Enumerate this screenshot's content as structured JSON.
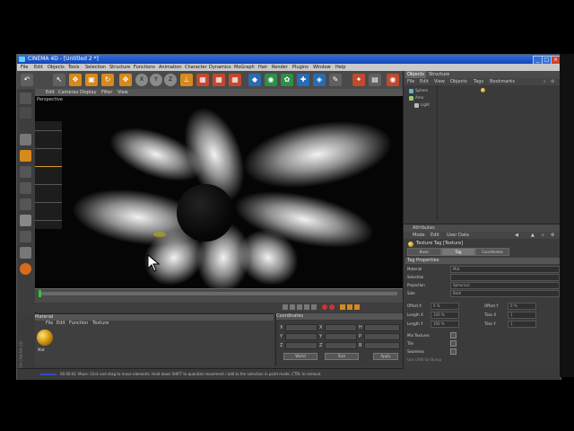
{
  "titlebar": {
    "title": "CINEMA 4D - [Untitled 2 *]"
  },
  "menubar": {
    "items": [
      "File",
      "Edit",
      "Objects",
      "Tools",
      "Selection",
      "Structure",
      "Functions",
      "Animation",
      "Character",
      "Dynamics",
      "MoGraph",
      "Hair",
      "Render",
      "Plugins",
      "Window",
      "Help"
    ]
  },
  "toolbar": {
    "axis_x": "X",
    "axis_y": "Y",
    "axis_z": "Z"
  },
  "viewport": {
    "menu": [
      "Edit",
      "Cameras",
      "Display",
      "Filter",
      "View"
    ],
    "label": "Perspective"
  },
  "material_manager": {
    "title": "Material",
    "menu": [
      "File",
      "Edit",
      "Function",
      "Texture"
    ],
    "material_name": "Mat"
  },
  "coordinates": {
    "title": "Coordinates",
    "labels": [
      "X",
      "Y",
      "Z",
      "X",
      "Y",
      "Z",
      "H",
      "P",
      "B"
    ],
    "world_label": "World",
    "size_label": "Size",
    "apply_label": "Apply"
  },
  "statusbar": {
    "time": "00:00:02",
    "message": "Move: Click and drag to move elements. Hold down SHIFT to quantize movement / add to the selection in point mode, CTRL to remove."
  },
  "object_manager": {
    "tabs": [
      "Objects",
      "Structure"
    ],
    "menu": [
      "File",
      "Edit",
      "View",
      "Objects",
      "Tags",
      "Bookmarks"
    ],
    "objects": [
      "Sphere",
      "Area",
      "Light"
    ]
  },
  "attributes": {
    "header": "Attributes",
    "menu": [
      "Mode",
      "Edit",
      "User Data"
    ],
    "title": "Texture Tag [Texture]",
    "tabs": [
      "Basic",
      "Tag",
      "Coordinates"
    ],
    "section": "Tag Properties",
    "fields": {
      "material_label": "Material",
      "material_value": "Mat",
      "selection_label": "Selection",
      "projection_label": "Projection",
      "projection_value": "Spherical",
      "side_label": "Side",
      "side_value": "Both",
      "offset_x_label": "Offset X",
      "offset_x_value": "0 %",
      "offset_y_label": "Offset Y",
      "offset_y_value": "0 %",
      "length_x_label": "Length X",
      "length_x_value": "100 %",
      "length_y_label": "Length Y",
      "length_y_value": "100 %",
      "tiles_x_label": "Tiles X",
      "tiles_x_value": "1",
      "tiles_y_label": "Tiles Y",
      "tiles_y_value": "1",
      "mix_label": "Mix Textures",
      "tile_label": "Tile",
      "seamless_label": "Seamless",
      "uvw_label": "Use UVW for Bump"
    }
  },
  "logo_text": "MAXON CINEMA 4D"
}
